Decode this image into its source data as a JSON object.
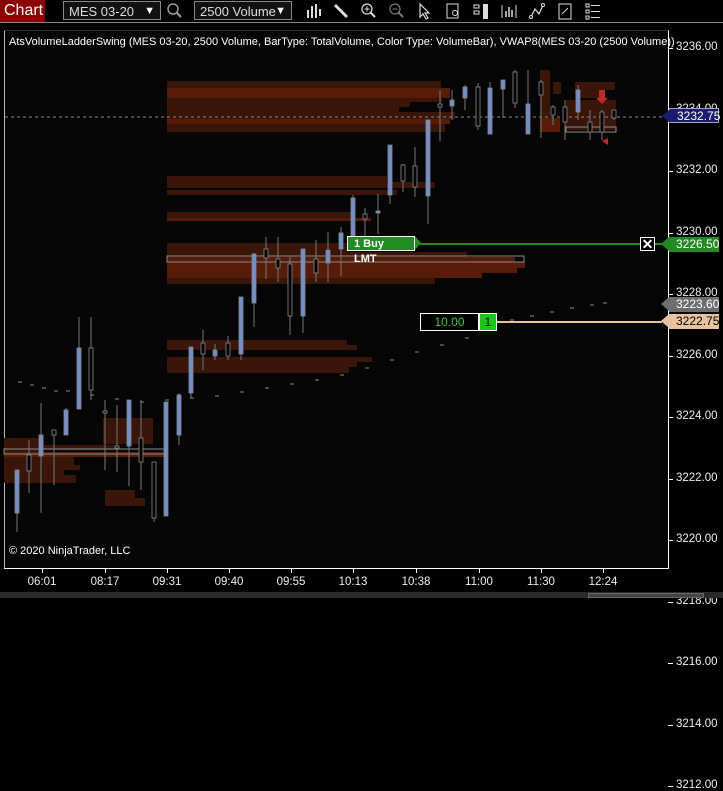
{
  "toolbar": {
    "tab_label": "Chart",
    "instrument": "MES 03-20",
    "bar_type": "2500 Volume",
    "icons": [
      "search-icon",
      "bar-style-icon",
      "drawing-tool-icon",
      "zoom-in-icon",
      "zoom-out-icon",
      "pointer-icon",
      "data-box-icon",
      "chart-trader-icon",
      "indicators-icon",
      "strategies-icon",
      "templates-icon",
      "properties-icon"
    ]
  },
  "chart": {
    "indicator_title": "AtsVolumeLadderSwing (MES 03-20, 2500 Volume, BarType: TotalVolume, Color Type: VolumeBar), VWAP8(MES 03-20 (2500 Volume))",
    "copyright": "© 2020 NinjaTrader, LLC",
    "y_axis": [
      "3236.00",
      "3234.00",
      "3232.00",
      "3230.00",
      "3228.00",
      "3226.00",
      "3224.00",
      "3222.00",
      "3220.00",
      "3218.00",
      "3216.00",
      "3214.00",
      "3212.00"
    ],
    "x_axis": [
      "06:01",
      "08:17",
      "09:31",
      "09:40",
      "09:55",
      "10:13",
      "10:38",
      "11:00",
      "11:30",
      "12:24"
    ],
    "last_price": "3232.75",
    "order_price": "3226.50",
    "vwap_price": "3223.60",
    "position_price": "3222.75",
    "order_label": "1  Buy LMT",
    "order_close": "✕",
    "position_pnl": "10.00",
    "position_qty": "1",
    "colors": {
      "last_price_bg": "#1c1c6e",
      "order_bg": "#228b22",
      "vwap_bg": "#6e6e6e",
      "position_bg": "#e8c39e",
      "ladder_dark": "#3a150a",
      "ladder_light": "#561c08",
      "up_candle": "#6f8fd0"
    }
  }
}
